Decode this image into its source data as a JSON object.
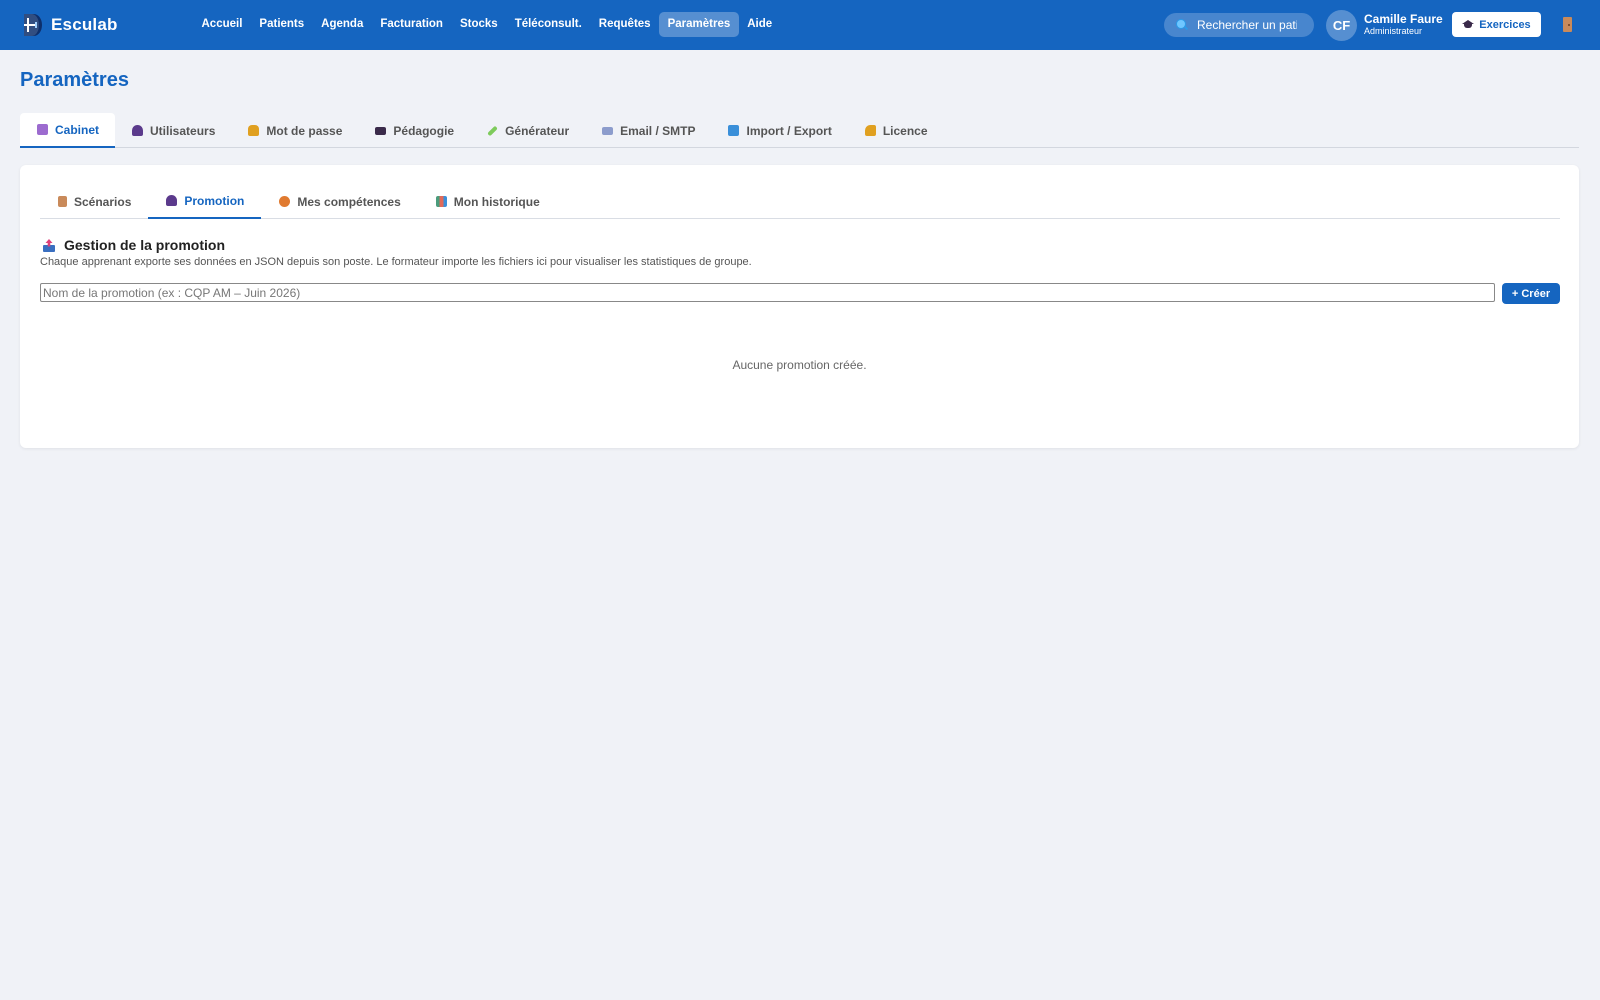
{
  "app": {
    "name": "Esculab",
    "brand_color": "#1565c0"
  },
  "nav": [
    {
      "label": "Accueil"
    },
    {
      "label": "Patients"
    },
    {
      "label": "Agenda"
    },
    {
      "label": "Facturation"
    },
    {
      "label": "Stocks"
    },
    {
      "label": "Téléconsult."
    },
    {
      "label": "Requêtes"
    },
    {
      "label": "Paramètres",
      "active": true
    },
    {
      "label": "Aide"
    }
  ],
  "search": {
    "placeholder": "Rechercher un patient…",
    "icon": "search-icon"
  },
  "user": {
    "initials": "CF",
    "name": "Camille Faure",
    "role": "Administrateur"
  },
  "header_actions": {
    "exercices_label": "Exercices",
    "exercices_icon": "graduation-cap-icon",
    "logout_icon": "door-icon"
  },
  "page": {
    "title": "Paramètres"
  },
  "main_tabs": [
    {
      "label": "Cabinet",
      "icon": "books-icon",
      "color": "#9c6bcf",
      "active": true
    },
    {
      "label": "Utilisateurs",
      "icon": "users-icon",
      "color": "#5b3a8c"
    },
    {
      "label": "Mot de passe",
      "icon": "lock-icon",
      "color": "#e0a020"
    },
    {
      "label": "Pédagogie",
      "icon": "graduation-cap-icon",
      "color": "#3a2a4a"
    },
    {
      "label": "Générateur",
      "icon": "syringe-icon",
      "color": "#7ecb5c"
    },
    {
      "label": "Email / SMTP",
      "icon": "email-icon",
      "color": "#8c9ccc"
    },
    {
      "label": "Import / Export",
      "icon": "refresh-icon",
      "color": "#3a8fd9"
    },
    {
      "label": "Licence",
      "icon": "key-icon",
      "color": "#e0a020"
    }
  ],
  "sub_tabs": [
    {
      "label": "Scénarios",
      "icon": "clipboard-icon",
      "color": "#c98a5a"
    },
    {
      "label": "Promotion",
      "icon": "users-icon",
      "color": "#5b3a8c",
      "active": true
    },
    {
      "label": "Mes compétences",
      "icon": "medal-icon",
      "color": "#e07a30"
    },
    {
      "label": "Mon historique",
      "icon": "bar-chart-icon",
      "color": "#4a9c7c"
    }
  ],
  "promotion": {
    "icon": "inbox-tray-icon",
    "title": "Gestion de la promotion",
    "description": "Chaque apprenant exporte ses données en JSON depuis son poste. Le formateur importe les fichiers ici pour visualiser les statistiques de groupe.",
    "name_placeholder": "Nom de la promotion (ex : CQP AM – Juin 2026)",
    "create_label": "+ Créer",
    "empty_message": "Aucune promotion créée."
  }
}
